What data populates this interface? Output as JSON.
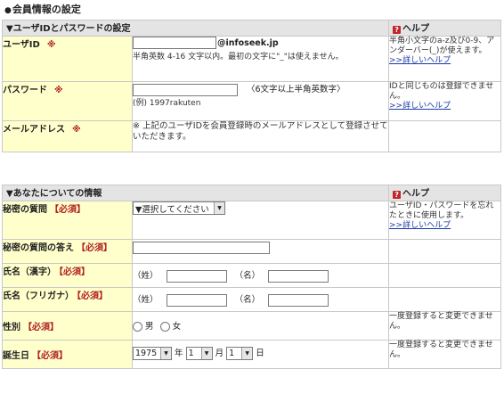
{
  "page": {
    "title": "会員情報の設定",
    "bullet": "●"
  },
  "section1": {
    "header": "▼ユーザIDとパスワードの設定",
    "help_header": "ヘルプ",
    "rows": {
      "userid": {
        "label": "ユーザID",
        "mark": "※",
        "value": "",
        "domain": "@infoseek.jp",
        "note": "半角英数 4-16 文字以内。最初の文字に\"_\"は使えません。",
        "help": "半角小文字のa-z及び0-9、アンダーバー(_)が使えます。",
        "help_link": ">>詳しいヘルプ"
      },
      "password": {
        "label": "パスワード",
        "mark": "※",
        "value": "",
        "hint": "〈6文字以上半角英数字〉",
        "example": "(例) 1997rakuten",
        "help": "IDと同じものは登録できません。",
        "help_link": ">>詳しいヘルプ"
      },
      "mail": {
        "label": "メールアドレス",
        "mark": "※",
        "note": "※ 上記のユーザIDを会員登録時のメールアドレスとして登録させていただきます。"
      }
    }
  },
  "section2": {
    "header": "▼あなたについての情報",
    "help_header": "ヘルプ",
    "required": "【必須】",
    "rows": {
      "secret_q": {
        "label": "秘密の質問",
        "select": "▼選択してください",
        "help": "ユーザID・パスワードを忘れたときに使用します。",
        "help_link": ">>詳しいヘルプ"
      },
      "secret_a": {
        "label": "秘密の質問の答え",
        "value": ""
      },
      "name_kanji": {
        "label": "氏名（漢字）",
        "sei": "（姓）",
        "mei": "（名）",
        "sei_value": "",
        "mei_value": ""
      },
      "name_kana": {
        "label": "氏名（フリガナ）",
        "sei": "（姓）",
        "mei": "（名）",
        "sei_value": "",
        "mei_value": ""
      },
      "gender": {
        "label": "性別",
        "male": "男",
        "female": "女",
        "help": "一度登録すると変更できません。"
      },
      "birthday": {
        "label": "誕生日",
        "year": "1975",
        "year_unit": "年",
        "month": "1",
        "month_unit": "月",
        "day": "1",
        "day_unit": "日",
        "help": "一度登録すると変更できません。"
      }
    }
  }
}
